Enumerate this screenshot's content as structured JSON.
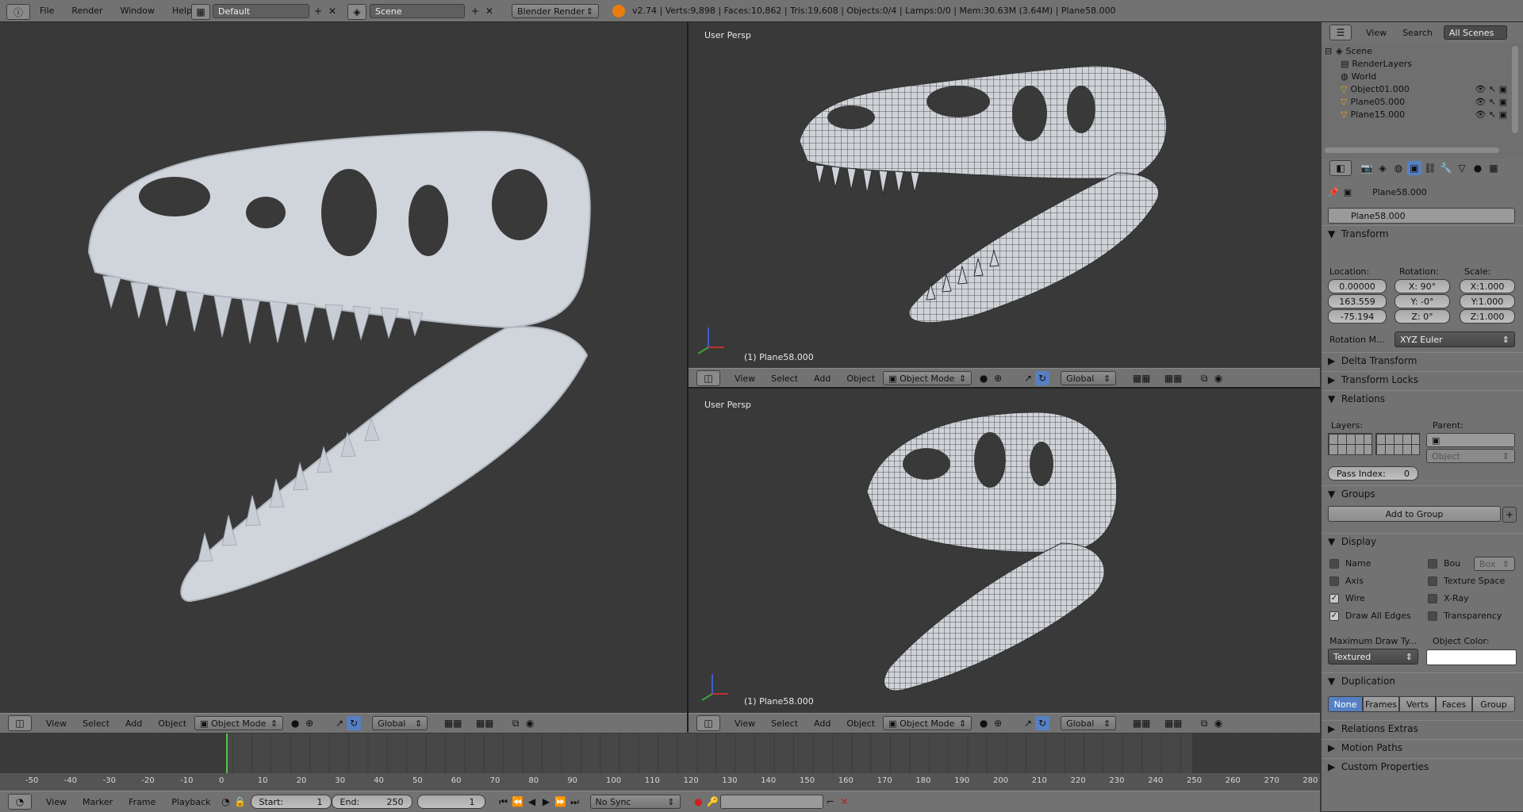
{
  "topbar": {
    "menus": [
      "File",
      "Render",
      "Window",
      "Help"
    ],
    "layout": "Default",
    "scene": "Scene",
    "engine": "Blender Render",
    "stats": "v2.74 | Verts:9,898 | Faces:10,862 | Tris:19,608 | Objects:0/4 | Lamps:0/0 | Mem:30.63M (3.64M) | Plane58.000"
  },
  "viewports": {
    "persp_label": "User Persp",
    "object_label": "(1) Plane58.000"
  },
  "vp_header": {
    "menus": [
      "View",
      "Select",
      "Add",
      "Object"
    ],
    "mode": "Object Mode",
    "orientation": "Global"
  },
  "outliner": {
    "menus": [
      "View",
      "Search"
    ],
    "filter": "All Scenes",
    "items": [
      "Scene",
      "RenderLayers",
      "World",
      "Object01.000",
      "Plane05.000",
      "Plane15.000"
    ]
  },
  "properties": {
    "context_object": "Plane58.000",
    "object_name": "Plane58.000",
    "transform": {
      "title": "Transform",
      "location_label": "Location:",
      "rotation_label": "Rotation:",
      "scale_label": "Scale:",
      "location": [
        "0.00000",
        "163.559",
        "-75.194"
      ],
      "rotation": [
        "X:   90°",
        "Y:   -0°",
        "Z:    0°"
      ],
      "scale": [
        "X:1.000",
        "Y:1.000",
        "Z:1.000"
      ],
      "rotation_mode_label": "Rotation M...",
      "rotation_mode": "XYZ Euler"
    },
    "delta_transform": "Delta Transform",
    "transform_locks": "Transform Locks",
    "relations": {
      "title": "Relations",
      "layers_label": "Layers:",
      "parent_label": "Parent:",
      "parent_type": "Object",
      "pass_index_label": "Pass Index:",
      "pass_index": "0"
    },
    "groups": {
      "title": "Groups",
      "add": "Add to Group"
    },
    "display": {
      "title": "Display",
      "name": "Name",
      "bounds": "Bou",
      "bounds_type": "Box",
      "axis": "Axis",
      "texture_space": "Texture Space",
      "wire": "Wire",
      "xray": "X-Ray",
      "draw_all_edges": "Draw All Edges",
      "transparency": "Transparency",
      "max_draw_label": "Maximum Draw Ty...",
      "max_draw": "Textured",
      "color_label": "Object Color:"
    },
    "duplication": {
      "title": "Duplication",
      "options": [
        "None",
        "Frames",
        "Verts",
        "Faces",
        "Group"
      ]
    },
    "relations_extras": "Relations Extras",
    "motion_paths": "Motion Paths",
    "custom_properties": "Custom Properties"
  },
  "timeline": {
    "ticks": [
      "-50",
      "-40",
      "-30",
      "-20",
      "-10",
      "0",
      "10",
      "20",
      "30",
      "40",
      "50",
      "60",
      "70",
      "80",
      "90",
      "100",
      "110",
      "120",
      "130",
      "140",
      "150",
      "160",
      "170",
      "180",
      "190",
      "200",
      "210",
      "220",
      "230",
      "240",
      "250",
      "260",
      "270",
      "280"
    ],
    "menus": [
      "View",
      "Marker",
      "Frame",
      "Playback"
    ],
    "start_label": "Start:",
    "start": "1",
    "end_label": "End:",
    "end": "250",
    "current": "1",
    "sync": "No Sync"
  },
  "colors": {
    "accent": "#5680c2",
    "header": "#727272",
    "viewport": "#393939"
  }
}
